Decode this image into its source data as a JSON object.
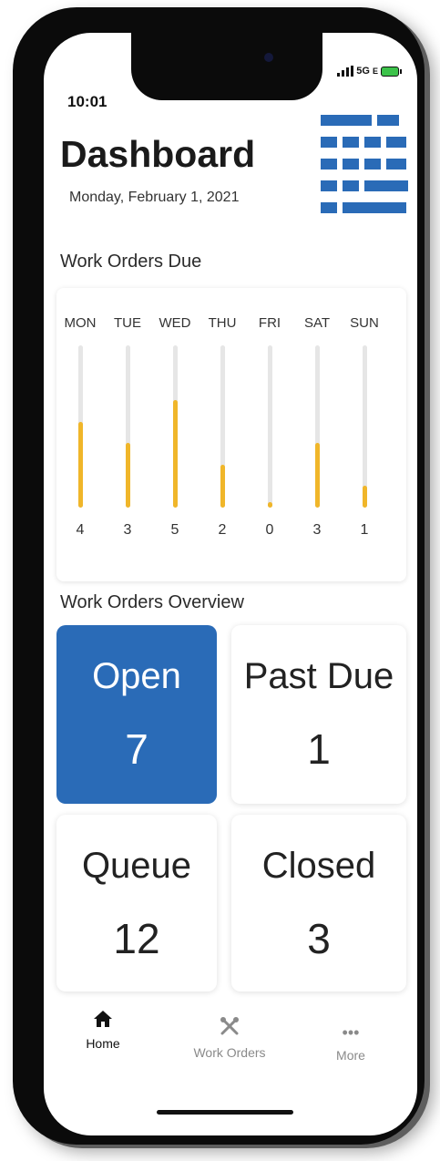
{
  "status_bar": {
    "time": "10:01",
    "network": "5G",
    "network_suffix": "E"
  },
  "header": {
    "title": "Dashboard",
    "date": "Monday, February 1, 2021",
    "menu_icon": "calendar-grid-icon"
  },
  "work_orders_due": {
    "title": "Work Orders Due",
    "max": 5,
    "days": [
      {
        "label": "MON",
        "count": "4",
        "value": 4
      },
      {
        "label": "TUE",
        "count": "3",
        "value": 3
      },
      {
        "label": "WED",
        "count": "5",
        "value": 5
      },
      {
        "label": "THU",
        "count": "2",
        "value": 2
      },
      {
        "label": "FRI",
        "count": "0",
        "value": 0
      },
      {
        "label": "SAT",
        "count": "3",
        "value": 3
      },
      {
        "label": "SUN",
        "count": "1",
        "value": 1
      }
    ]
  },
  "overview": {
    "title": "Work Orders Overview",
    "tiles": [
      {
        "label": "Open",
        "count": "7"
      },
      {
        "label": "Past Due",
        "count": "1"
      },
      {
        "label": "Queue",
        "count": "12"
      },
      {
        "label": "Closed",
        "count": "3"
      }
    ]
  },
  "tab_bar": {
    "tabs": [
      {
        "label": "Home",
        "icon": "home-icon"
      },
      {
        "label": "Work Orders",
        "icon": "tools-icon"
      },
      {
        "label": "More",
        "icon": "more-icon"
      }
    ]
  },
  "colors": {
    "accent": "#2a6bb7",
    "bar_fill": "#f0b62a",
    "bar_track": "#e6e6e6"
  }
}
